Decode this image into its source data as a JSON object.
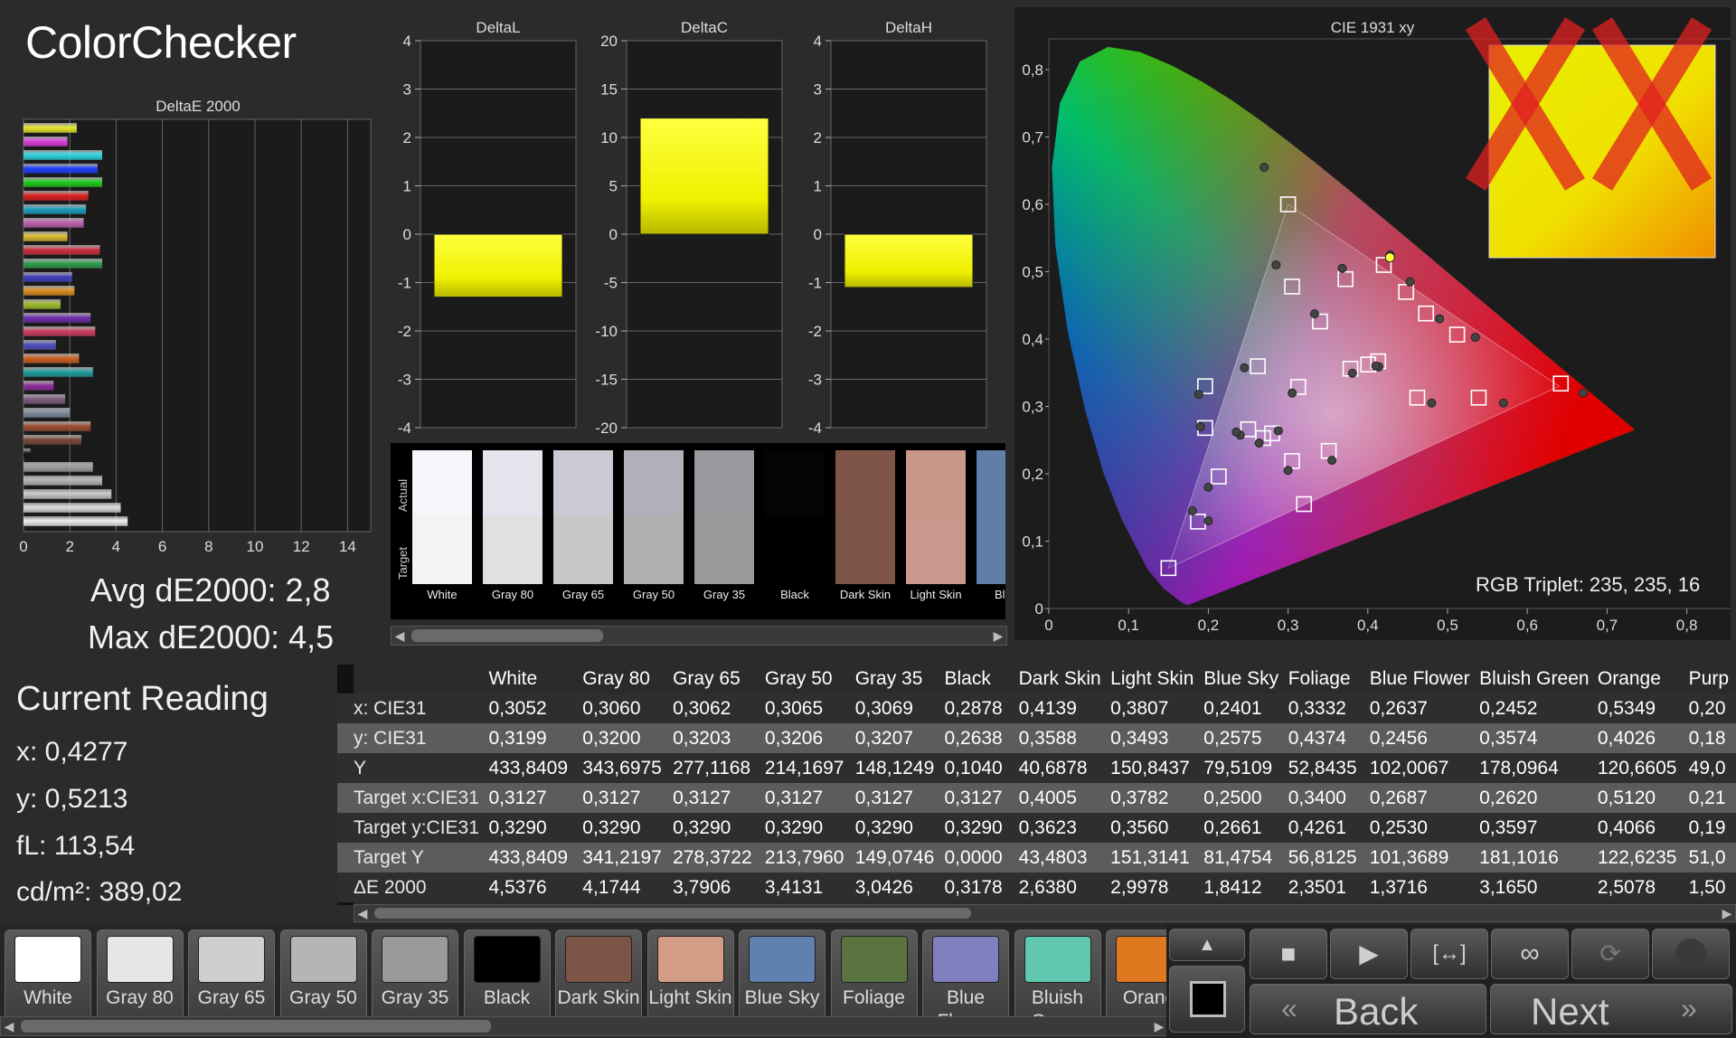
{
  "app": {
    "title": "ColorChecker"
  },
  "de_chart": {
    "title": "DeltaE 2000",
    "ticks": [
      "0",
      "2",
      "4",
      "6",
      "8",
      "10",
      "12",
      "14"
    ],
    "xmax": 15,
    "bars": [
      {
        "v": 2.3,
        "c": "#e9e92c"
      },
      {
        "v": 1.9,
        "c": "#e040e0"
      },
      {
        "v": 3.4,
        "c": "#30d8e0"
      },
      {
        "v": 3.2,
        "c": "#2040ff"
      },
      {
        "v": 3.4,
        "c": "#20d020"
      },
      {
        "v": 2.8,
        "c": "#e02020"
      },
      {
        "v": 2.7,
        "c": "#20a0c0"
      },
      {
        "v": 2.6,
        "c": "#c060b0"
      },
      {
        "v": 1.9,
        "c": "#e0c030"
      },
      {
        "v": 3.3,
        "c": "#d03040"
      },
      {
        "v": 3.4,
        "c": "#30a050"
      },
      {
        "v": 2.1,
        "c": "#4040c0"
      },
      {
        "v": 2.2,
        "c": "#e09020"
      },
      {
        "v": 1.6,
        "c": "#a0c030"
      },
      {
        "v": 2.9,
        "c": "#7030b0"
      },
      {
        "v": 3.1,
        "c": "#d04060"
      },
      {
        "v": 1.4,
        "c": "#5050c0"
      },
      {
        "v": 2.4,
        "c": "#d06020"
      },
      {
        "v": 3.0,
        "c": "#20a0a0"
      },
      {
        "v": 1.3,
        "c": "#9030a0"
      },
      {
        "v": 1.8,
        "c": "#806080"
      },
      {
        "v": 2.0,
        "c": "#8090a0"
      },
      {
        "v": 2.9,
        "c": "#a05030"
      },
      {
        "v": 2.5,
        "c": "#7a4a3a"
      },
      {
        "v": 0.3,
        "c": "#151515"
      },
      {
        "v": 3.0,
        "c": "#a0a0a0"
      },
      {
        "v": 3.4,
        "c": "#b8b8b8"
      },
      {
        "v": 3.8,
        "c": "#cccccc"
      },
      {
        "v": 4.2,
        "c": "#dddddd"
      },
      {
        "v": 4.5,
        "c": "#f0f0f0"
      }
    ]
  },
  "stats": {
    "avg": "Avg dE2000: 2,8",
    "max": "Max dE2000: 4,5"
  },
  "delta_charts": [
    {
      "title": "DeltaL",
      "ticks": [
        "4",
        "3",
        "2",
        "1",
        "0",
        "-1",
        "-2",
        "-3",
        "-4"
      ],
      "min": -4,
      "max": 4,
      "value": -1.3
    },
    {
      "title": "DeltaC",
      "ticks": [
        "20",
        "15",
        "10",
        "5",
        "0",
        "-5",
        "-10",
        "-15",
        "-20"
      ],
      "min": -20,
      "max": 20,
      "value": 12.0
    },
    {
      "title": "DeltaH",
      "ticks": [
        "4",
        "3",
        "2",
        "1",
        "0",
        "-1",
        "-2",
        "-3",
        "-4"
      ],
      "min": -4,
      "max": 4,
      "value": -1.1
    }
  ],
  "swatches": {
    "actual_label": "Actual",
    "target_label": "Target",
    "items": [
      {
        "name": "White",
        "actual": "#f5f6fb",
        "target": "#f3f3f3"
      },
      {
        "name": "Gray 80",
        "actual": "#e3e4ec",
        "target": "#e0e0e0"
      },
      {
        "name": "Gray 65",
        "actual": "#c9cad3",
        "target": "#c8c8c8"
      },
      {
        "name": "Gray 50",
        "actual": "#b0b1b8",
        "target": "#b0b0b0"
      },
      {
        "name": "Gray 35",
        "actual": "#98989e",
        "target": "#999999"
      },
      {
        "name": "Black",
        "actual": "#050505",
        "target": "#000000"
      },
      {
        "name": "Dark Skin",
        "actual": "#7e5548",
        "target": "#7d5547"
      },
      {
        "name": "Light Skin",
        "actual": "#c9978a",
        "target": "#c7988b"
      },
      {
        "name": "Blue",
        "actual": "#5f7fa8",
        "target": "#5f7fa8"
      }
    ]
  },
  "cie": {
    "title": "CIE 1931 xy",
    "x_ticks": [
      "0",
      "0,1",
      "0,2",
      "0,3",
      "0,4",
      "0,5",
      "0,6",
      "0,7",
      "0,8"
    ],
    "y_ticks": [
      "0",
      "0,1",
      "0,2",
      "0,3",
      "0,4",
      "0,5",
      "0,6",
      "0,7",
      "0,8"
    ],
    "rgb_triplet": "RGB Triplet: 235, 235, 16",
    "gamut": {
      "r": [
        0.64,
        0.33
      ],
      "g": [
        0.3,
        0.6
      ],
      "b": [
        0.15,
        0.06
      ]
    },
    "targets": [
      [
        0.3127,
        0.329
      ],
      [
        0.4005,
        0.3623
      ],
      [
        0.3782,
        0.356
      ],
      [
        0.25,
        0.2661
      ],
      [
        0.34,
        0.4261
      ],
      [
        0.2687,
        0.253
      ],
      [
        0.262,
        0.3597
      ],
      [
        0.512,
        0.4066
      ],
      [
        0.213,
        0.196
      ],
      [
        0.462,
        0.313
      ],
      [
        0.372,
        0.489
      ],
      [
        0.473,
        0.438
      ],
      [
        0.187,
        0.129
      ],
      [
        0.305,
        0.478
      ],
      [
        0.539,
        0.313
      ],
      [
        0.448,
        0.47
      ],
      [
        0.351,
        0.234
      ],
      [
        0.196,
        0.268
      ],
      [
        0.642,
        0.334
      ],
      [
        0.3,
        0.6
      ],
      [
        0.15,
        0.06
      ],
      [
        0.196,
        0.33
      ],
      [
        0.305,
        0.219
      ],
      [
        0.413,
        0.367
      ],
      [
        0.28,
        0.26
      ],
      [
        0.32,
        0.155
      ],
      [
        0.42,
        0.51
      ]
    ],
    "actuals": [
      [
        0.3052,
        0.3199
      ],
      [
        0.4139,
        0.3588
      ],
      [
        0.3807,
        0.3493
      ],
      [
        0.2401,
        0.2575
      ],
      [
        0.3332,
        0.4374
      ],
      [
        0.2637,
        0.2456
      ],
      [
        0.2452,
        0.3574
      ],
      [
        0.5349,
        0.4026
      ],
      [
        0.2,
        0.18
      ],
      [
        0.48,
        0.305
      ],
      [
        0.368,
        0.505
      ],
      [
        0.49,
        0.43
      ],
      [
        0.18,
        0.145
      ],
      [
        0.285,
        0.51
      ],
      [
        0.57,
        0.305
      ],
      [
        0.453,
        0.485
      ],
      [
        0.355,
        0.22
      ],
      [
        0.188,
        0.318
      ],
      [
        0.67,
        0.32
      ],
      [
        0.27,
        0.655
      ],
      [
        0.2878,
        0.2638
      ],
      [
        0.19,
        0.27
      ],
      [
        0.3,
        0.205
      ],
      [
        0.41,
        0.36
      ],
      [
        0.235,
        0.262
      ],
      [
        0.2,
        0.13
      ],
      [
        0.428,
        0.525
      ]
    ],
    "current": {
      "x": 0.4277,
      "y": 0.5213
    }
  },
  "reading": {
    "title": "Current Reading",
    "x": "x: 0,4277",
    "y": "y: 0,5213",
    "fl": "fL: 113,54",
    "cdm2": "cd/m²: 389,02"
  },
  "table": {
    "columns": [
      "White",
      "Gray 80",
      "Gray 65",
      "Gray 50",
      "Gray 35",
      "Black",
      "Dark Skin",
      "Light Skin",
      "Blue Sky",
      "Foliage",
      "Blue Flower",
      "Bluish Green",
      "Orange",
      "Purp"
    ],
    "rows": [
      {
        "label": "x: CIE31",
        "values": [
          "0,3052",
          "0,3060",
          "0,3062",
          "0,3065",
          "0,3069",
          "0,2878",
          "0,4139",
          "0,3807",
          "0,2401",
          "0,3332",
          "0,2637",
          "0,2452",
          "0,5349",
          "0,20"
        ]
      },
      {
        "label": "y: CIE31",
        "values": [
          "0,3199",
          "0,3200",
          "0,3203",
          "0,3206",
          "0,3207",
          "0,2638",
          "0,3588",
          "0,3493",
          "0,2575",
          "0,4374",
          "0,2456",
          "0,3574",
          "0,4026",
          "0,18"
        ]
      },
      {
        "label": "Y",
        "values": [
          "433,8409",
          "343,6975",
          "277,1168",
          "214,1697",
          "148,1249",
          "0,1040",
          "40,6878",
          "150,8437",
          "79,5109",
          "52,8435",
          "102,0067",
          "178,0964",
          "120,6605",
          "49,0"
        ]
      },
      {
        "label": "Target x:CIE31",
        "values": [
          "0,3127",
          "0,3127",
          "0,3127",
          "0,3127",
          "0,3127",
          "0,3127",
          "0,4005",
          "0,3782",
          "0,2500",
          "0,3400",
          "0,2687",
          "0,2620",
          "0,5120",
          "0,21"
        ]
      },
      {
        "label": "Target y:CIE31",
        "values": [
          "0,3290",
          "0,3290",
          "0,3290",
          "0,3290",
          "0,3290",
          "0,3290",
          "0,3623",
          "0,3560",
          "0,2661",
          "0,4261",
          "0,2530",
          "0,3597",
          "0,4066",
          "0,19"
        ]
      },
      {
        "label": "Target Y",
        "values": [
          "433,8409",
          "341,2197",
          "278,3722",
          "213,7960",
          "149,0746",
          "0,0000",
          "43,4803",
          "151,3141",
          "81,4754",
          "56,8125",
          "101,3689",
          "181,1016",
          "122,6235",
          "51,0"
        ]
      },
      {
        "label": "ΔE 2000",
        "values": [
          "4,5376",
          "4,1744",
          "3,7906",
          "3,4131",
          "3,0426",
          "0,3178",
          "2,6380",
          "2,9978",
          "1,8412",
          "2,3501",
          "1,3716",
          "3,1650",
          "2,5078",
          "1,50"
        ]
      }
    ]
  },
  "patches": [
    {
      "name": "White",
      "color": "#ffffff"
    },
    {
      "name": "Gray 80",
      "color": "#e6e6e6"
    },
    {
      "name": "Gray 65",
      "color": "#cfcfcf"
    },
    {
      "name": "Gray 50",
      "color": "#b5b5b5"
    },
    {
      "name": "Gray 35",
      "color": "#9a9a9a"
    },
    {
      "name": "Black",
      "color": "#000000"
    },
    {
      "name": "Dark Skin",
      "color": "#7d5547"
    },
    {
      "name": "Light Skin",
      "color": "#d39c86"
    },
    {
      "name": "Blue Sky",
      "color": "#5f80b0"
    },
    {
      "name": "Foliage",
      "color": "#5a7440"
    },
    {
      "name": "Blue Flower",
      "color": "#8080c0"
    },
    {
      "name": "Bluish Green",
      "color": "#60c8b0"
    },
    {
      "name": "Orang",
      "color": "#e07820"
    }
  ],
  "controls": {
    "back": "Back",
    "next": "Next"
  }
}
